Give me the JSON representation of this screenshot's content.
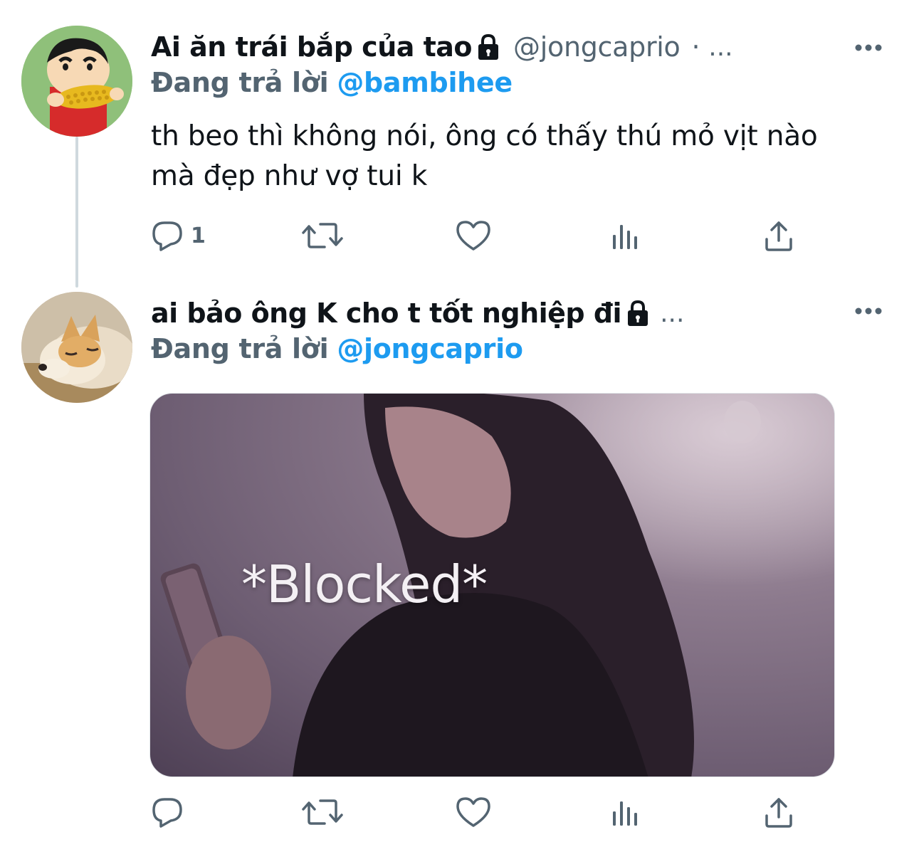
{
  "tweets": [
    {
      "display_name": "Ai ăn trái bắp của tao",
      "handle": "@jongcaprio",
      "separator": "·",
      "truncation": "...",
      "protected": true,
      "reply_label": "Đang trả lời",
      "reply_to": "@bambihee",
      "text": "th beo thì không nói, ông có thấy thú mỏ vịt nào mà đẹp như vợ tui k",
      "reply_count": "1",
      "avatar_icon": "cartoon-boy-eating-corn-avatar"
    },
    {
      "display_name": "ai bảo ông K cho t tốt nghiệp đi",
      "truncation": "...",
      "protected": true,
      "reply_label": "Đang trả lời",
      "reply_to": "@jongcaprio",
      "media_caption": "*Blocked*",
      "avatar_icon": "sleeping-dog-avatar"
    }
  ],
  "icons": {
    "reply": "reply-icon",
    "retweet": "retweet-icon",
    "like": "heart-icon",
    "analytics": "analytics-icon",
    "share": "share-icon",
    "more": "more-options-icon",
    "lock": "lock-icon"
  },
  "colors": {
    "text_primary": "#0f1419",
    "text_secondary": "#536471",
    "accent": "#1d9bf0",
    "thread_line": "#cfd9de"
  }
}
